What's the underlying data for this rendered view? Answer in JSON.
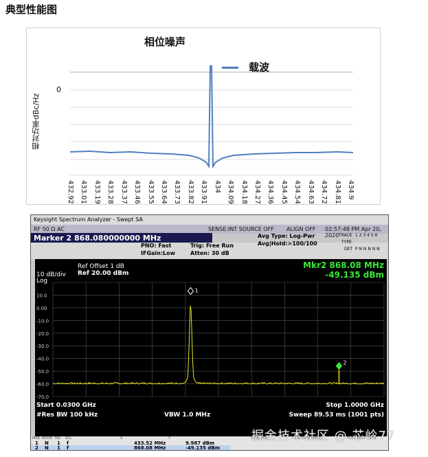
{
  "page": {
    "title": "典型性能图"
  },
  "phase_noise": {
    "title": "相位噪声",
    "ylabel": "相对功率dBc/Hz",
    "zero_label": "0",
    "legend": "载波",
    "line_color": "#4f7fbf",
    "x_ticks": [
      "432.92",
      "433.01",
      "433.19",
      "433.28",
      "433.37",
      "433.46",
      "433.55",
      "433.64",
      "433.73",
      "433.82",
      "433.91",
      "434",
      "434.09",
      "434.18",
      "434.27",
      "434.36",
      "434.45",
      "434.54",
      "434.63",
      "434.72",
      "434.81",
      "434.9"
    ]
  },
  "analyzer": {
    "window_title": "Keysight Spectrum Analyzer - Swept SA",
    "hdr_left": "RF     50 Ω  AC",
    "hdr_sense": "SENSE:INT  SOURCE OFF",
    "hdr_align": "ALIGN OFF",
    "hdr_time": "02:57:48 PM Apr 20, 2020",
    "marker_readout": "Marker 2  868.080000000 MHz",
    "pno": "PNO: Fast",
    "ifgain": "IFGain:Low",
    "trig": "Trig: Free Run",
    "atten": "Atten: 30 dB",
    "avg_type": "Avg Type: Log-Pwr",
    "avg_hold": "Avg|Hold:>100/100",
    "trace_label": "TRACE",
    "type_label": "TYPE",
    "det_label": "DET",
    "trace_nums": "1 2 3 4 5 6",
    "det_value": "P N N N N N",
    "ref_offset": "Ref Offset 1 dB",
    "ref_level": "Ref 20.00 dBm",
    "scale": "10 dB/div",
    "scale_type": "Log",
    "mkr_readout_freq": "Mkr2  868.08 MHz",
    "mkr_readout_amp": "-49.135 dBm",
    "y_ticks": [
      "10.0",
      "0.00",
      "-10.0",
      "-20.0",
      "-30.0",
      "-40.0",
      "-50.0",
      "-60.0",
      "-70.0"
    ],
    "start": "Start 0.0300 GHz",
    "stop": "Stop 1.0000 GHz",
    "rbw": "#Res BW 100 kHz",
    "vbw": "VBW 1.0 MHz",
    "sweep": "Sweep  89.53 ms (1001 pts)",
    "marker1_label": "1",
    "marker2_label": "2",
    "table_headers": [
      "MKR",
      "MODE",
      "TRC",
      "SCL",
      "X",
      "Y",
      "FUNCTION",
      "FUNCTION WIDTH",
      "FUNCTION VALUE"
    ],
    "table_rows": [
      {
        "mkr": "1",
        "mode": "N",
        "trc": "1",
        "scl": "f",
        "x": "433.52 MHz",
        "y": "9.987 dBm"
      },
      {
        "mkr": "2",
        "mode": "N",
        "trc": "1",
        "scl": "f",
        "x": "868.08 MHz",
        "y": "-49.135 dBm"
      }
    ],
    "colors": {
      "trace": "#e6e620",
      "marker": "#37e837",
      "grid": "#555555"
    }
  },
  "watermark": "掘金技术社区 @ 芯岭77"
}
